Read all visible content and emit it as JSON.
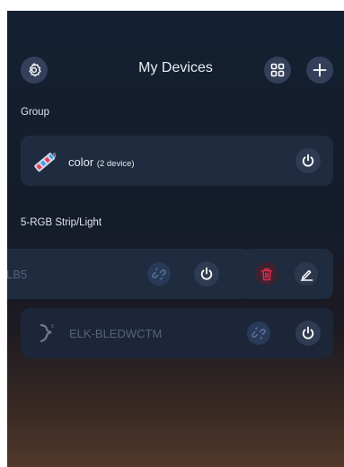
{
  "status": {
    "time": "",
    "right_text": ""
  },
  "header": {
    "title": "My Devices",
    "settings_icon": "gear-icon",
    "grid_icon": "grid-icon",
    "add_icon": "plus-icon"
  },
  "sections": {
    "group_label": "Group",
    "strip_label": "5-RGB Strip/Light"
  },
  "group_card": {
    "name": "color",
    "device_count": "(2 device)",
    "icon": "rgb-strip-icon",
    "power_icon": "power-icon"
  },
  "device_swiped": {
    "name_partial": "LB5",
    "link_icon": "unlink-icon",
    "power_icon": "power-icon"
  },
  "swipe_actions": {
    "delete_icon": "trash-icon",
    "edit_icon": "edit-icon",
    "delete_color": "#e0284a"
  },
  "device_2": {
    "name": "ELK-BLEDWCTM",
    "icon": "strip-light-icon",
    "link_icon": "unlink-icon",
    "power_icon": "power-icon"
  },
  "colors": {
    "accent": "#ffffff",
    "delete_red": "#e0284a",
    "card_bg": "#1f2b3e"
  }
}
